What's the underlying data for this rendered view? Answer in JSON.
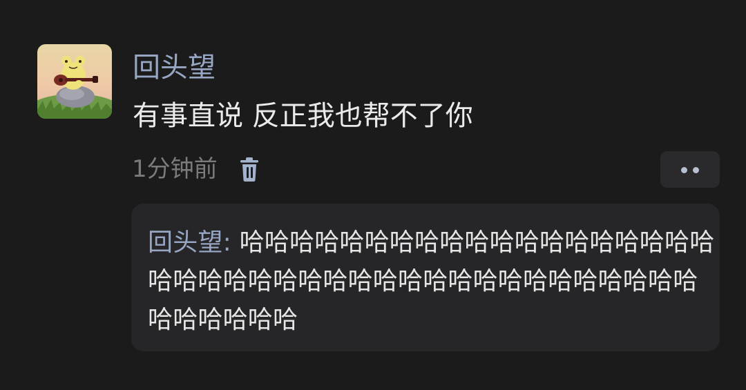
{
  "comment": {
    "username": "回头望",
    "content": "有事直说 反正我也帮不了你",
    "time_ago": "1分钟前",
    "delete_icon": "trash-icon",
    "more_icon": "more-dots-icon",
    "reply": {
      "author": "回头望",
      "separator": ": ",
      "text": "哈哈哈哈哈哈哈哈哈哈哈哈哈哈哈哈哈哈哈哈哈哈哈哈哈哈哈哈哈哈哈哈哈哈哈哈哈哈哈哈哈哈哈哈哈哈哈"
    }
  },
  "colors": {
    "background": "#1b1b1c",
    "username": "#97a7c3",
    "content": "#ebebeb",
    "meta": "#7b7b7d",
    "reply_background": "#262628"
  }
}
